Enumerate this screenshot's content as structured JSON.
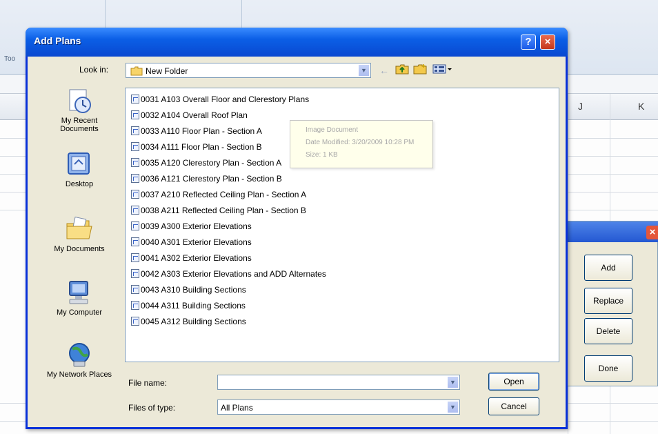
{
  "background": {
    "ribbon_label": "Too",
    "column_letters": [
      "J",
      "K"
    ],
    "panel": {
      "close_glyph": "×",
      "buttons": [
        "Add",
        "Replace",
        "Delete",
        "Done"
      ]
    }
  },
  "dialog": {
    "title": "Add Plans",
    "help_glyph": "?",
    "close_glyph": "×",
    "look_in": {
      "label": "Look in:",
      "value": "New Folder"
    },
    "places": [
      {
        "label": "My Recent Documents",
        "icon": "recent-documents-icon"
      },
      {
        "label": "Desktop",
        "icon": "desktop-icon"
      },
      {
        "label": "My Documents",
        "icon": "my-documents-icon"
      },
      {
        "label": "My Computer",
        "icon": "my-computer-icon"
      },
      {
        "label": "My Network Places",
        "icon": "network-places-icon"
      }
    ],
    "files": [
      "0031 A103 Overall Floor and Clerestory Plans",
      "0032 A104 Overall Roof Plan",
      "0033 A110 Floor Plan - Section A",
      "0034 A111 Floor Plan - Section B",
      "0035 A120 Clerestory Plan - Section A",
      "0036 A121 Clerestory Plan - Section B",
      "0037 A210 Reflected Ceiling Plan - Section A",
      "0038 A211 Reflected Ceiling Plan - Section B",
      "0039 A300 Exterior Elevations",
      "0040 A301 Exterior Elevations",
      "0041 A302 Exterior Elevations",
      "0042 A303 Exterior Elevations and ADD Alternates",
      "0043 A310 Building Sections",
      "0044 A311 Building Sections",
      "0045 A312 Building Sections"
    ],
    "tooltip": {
      "line1": "Image Document",
      "line2": "Date Modified: 3/20/2009 10:28 PM",
      "line3": "Size: 1 KB"
    },
    "file_name": {
      "label": "File name:",
      "value": ""
    },
    "files_of_type": {
      "label": "Files of type:",
      "value": "All Plans"
    },
    "open_label": "Open",
    "cancel_label": "Cancel"
  }
}
